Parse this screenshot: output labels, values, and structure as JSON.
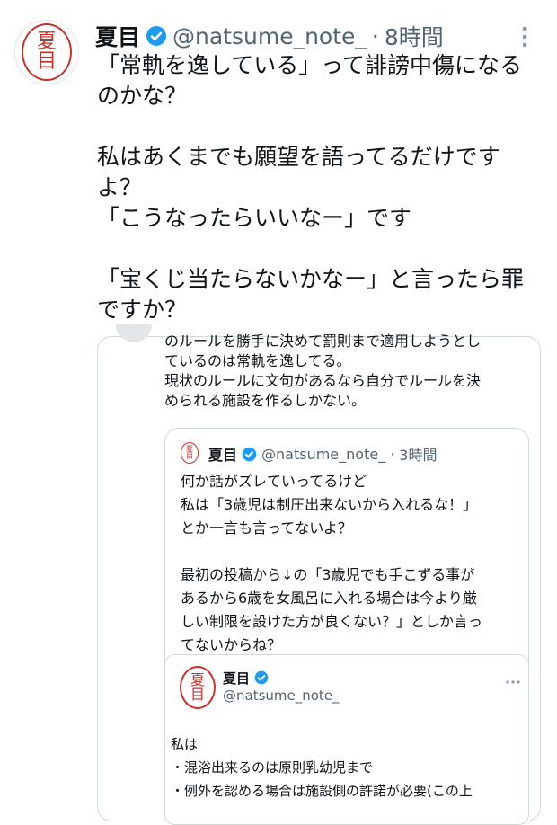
{
  "main_tweet": {
    "display_name": "夏目",
    "handle": "@natsume_note_",
    "separator": "·",
    "time": "8時間",
    "avatar_chars": [
      "夏",
      "目"
    ],
    "lines": [
      "「常軌を逸している」って誹謗中傷になる",
      "のかな？",
      "",
      "私はあくまでも願望を語ってるだけです",
      "よ？",
      "「こうなったらいいなー」です",
      "",
      "「宝くじ当たらないかなー」と言ったら罪",
      "ですか？"
    ]
  },
  "quoted_tweet": {
    "lines": [
      "のルールを勝手に決めて罰則まで適用しようとし",
      "ているのは常軌を逸してる。",
      "現状のルールに文句があるなら自分でルールを決",
      "められる施設を作るしかない。"
    ]
  },
  "nested_quote": {
    "display_name": "夏目",
    "handle": "@natsume_note_",
    "separator": "·",
    "time": "3時間",
    "avatar_chars": [
      "夏",
      "目"
    ],
    "lines": [
      "何か話がズレていってるけど",
      "私は「3歳児は制圧出来ないから入れるな！」",
      "とか一言も言ってないよ？",
      "",
      "最初の投稿から↓の「3歳児でも手こずる事が",
      "あるから6歳を女風呂に入れる場合は今より厳",
      "しい制限を設けた方が良くない？」としか言っ",
      "てないからね？"
    ]
  },
  "inner_tweet": {
    "display_name": "夏目",
    "handle": "@natsume_note_",
    "avatar_chars": [
      "夏",
      "目"
    ],
    "lines": [
      "私は",
      "・混浴出来るのは原則乳幼児まで",
      "・例外を認める場合は施設側の許諾が必要(この上"
    ]
  },
  "icons": {
    "verified": "verified-badge-icon",
    "more": "more-options-icon"
  },
  "colors": {
    "verified_blue": "#1d9bf0",
    "seal_red": "#c8322a",
    "secondary_text": "#536471",
    "border": "#cfd9de"
  }
}
